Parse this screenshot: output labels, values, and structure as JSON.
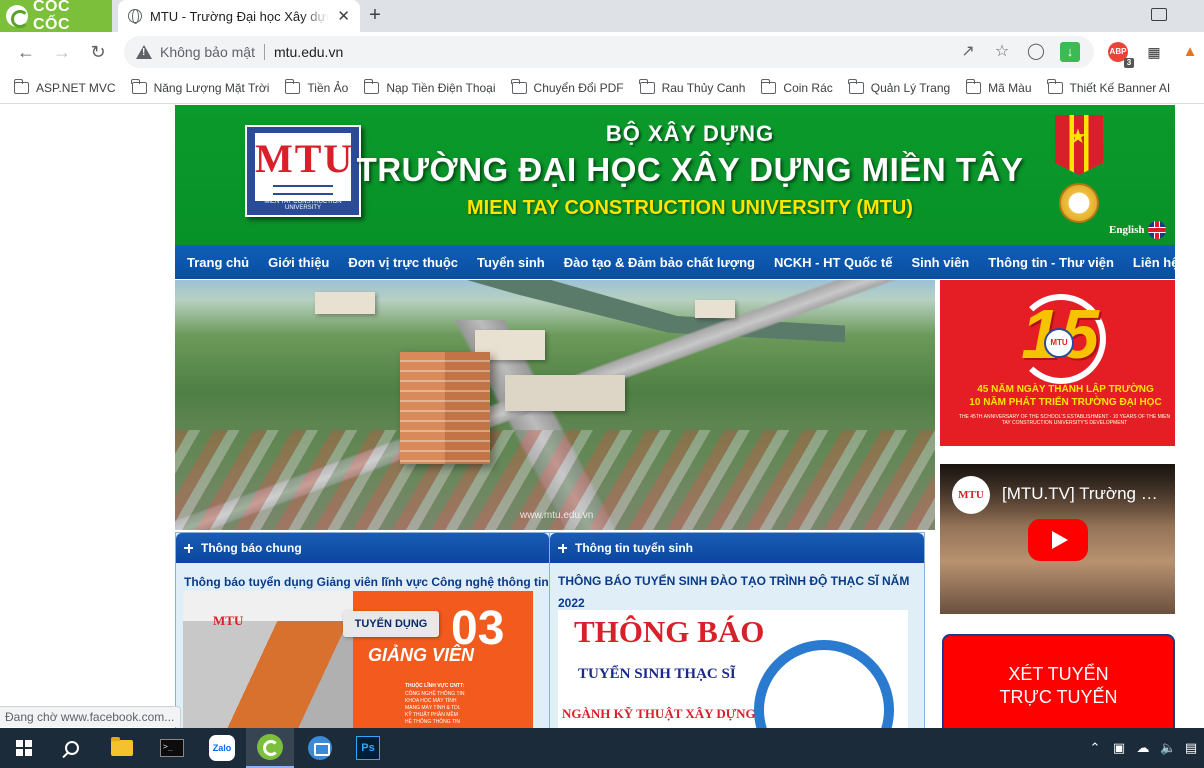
{
  "browser": {
    "brand": "CỐC CỐC",
    "tab_title": "MTU - Trường Đại học Xây dựng Miền Tây",
    "tab_close": "✕",
    "new_tab": "+",
    "security_label": "Không bảo mật",
    "url": "mtu.edu.vn",
    "abp_badge": "3",
    "abp_label": "ABP"
  },
  "bookmarks": [
    {
      "label": "ASP.NET MVC"
    },
    {
      "label": "Năng Lượng Mặt Trời"
    },
    {
      "label": "Tiền Ảo"
    },
    {
      "label": "Nạp Tiền Điện Thoại"
    },
    {
      "label": "Chuyển Đổi PDF"
    },
    {
      "label": "Rau Thủy Canh"
    },
    {
      "label": "Coin Rác"
    },
    {
      "label": "Quản Lý Trang"
    },
    {
      "label": "Mã Màu"
    },
    {
      "label": "Thiết Kế Banner AI"
    }
  ],
  "site": {
    "logo_letters": "MTU",
    "logo_caption": "MIEN TAY CONSTRUCTION UNIVERSITY",
    "ministry": "BỘ XÂY DỰNG",
    "university_name": "TRƯỜNG ĐẠI HỌC XÂY DỰNG MIỀN TÂY",
    "university_name_en": "MIEN TAY CONSTRUCTION UNIVERSITY (MTU)",
    "english_link": "English",
    "hero_watermark": "www.mtu.edu.vn",
    "nav": [
      {
        "label": "Trang chủ"
      },
      {
        "label": "Giới thiệu"
      },
      {
        "label": "Đơn vị trực thuộc"
      },
      {
        "label": "Tuyển sinh"
      },
      {
        "label": "Đào tạo & Đảm bảo chất lượng"
      },
      {
        "label": "NCKH - HT Quốc tế"
      },
      {
        "label": "Sinh viên"
      },
      {
        "label": "Thông tin - Thư viện"
      },
      {
        "label": "Liên hệ"
      }
    ]
  },
  "sidebar": {
    "anniversary": {
      "number": "15",
      "badge": "MTU",
      "line1": "45 NĂM NGÀY THÀNH LẬP TRƯỜNG",
      "line2": "10 NĂM PHÁT TRIỂN TRƯỜNG ĐẠI HỌC",
      "small": "THE 45TH ANNIVERSARY OF THE SCHOOL'S ESTABLISHMENT · 10 YEARS OF THE MIEN TAY CONSTRUCTION UNIVERSITY'S DEVELOPMENT"
    },
    "video": {
      "channel": "MTU",
      "title": "[MTU.TV] Trường Đại học Xây dựng Miền Tây"
    },
    "apply": {
      "line1": "XÉT TUYỂN",
      "line2": "TRỰC TUYẾN"
    }
  },
  "panels": {
    "general": {
      "title": "Thông báo chung",
      "link": "Thông báo tuyển dụng Giảng viên lĩnh vực Công nghệ thông tin",
      "image": {
        "logo": "MTU",
        "tag": "TUYỂN DỤNG",
        "number": "03",
        "role": "GIẢNG VIÊN",
        "field": "THUỘC LĨNH VỰC CNTT:",
        "list": [
          "CÔNG NGHỆ THÔNG TIN",
          "KHOA HỌC MÁY TÍNH",
          "MẠNG MÁY TÍNH & TDL",
          "KỸ THUẬT PHẦN MỀM",
          "HỆ THỐNG THÔNG TIN"
        ]
      }
    },
    "admission": {
      "title": "Thông tin tuyển sinh",
      "link": "THÔNG BÁO TUYỂN SINH ĐÀO TẠO TRÌNH ĐỘ THẠC SĨ NĂM 2022",
      "image": {
        "t1": "THÔNG BÁO",
        "t2": "TUYỂN SINH THẠC SĨ",
        "t3": "NGÀNH KỸ THUẬT XÂY DỰNG"
      }
    }
  },
  "status_text": "Đang chờ www.facebook.com...",
  "colors": {
    "banner_green": "#079127",
    "nav_blue": "#0a4ea0",
    "accent_red": "#e51e26",
    "link_blue": "#0a3a8a"
  }
}
